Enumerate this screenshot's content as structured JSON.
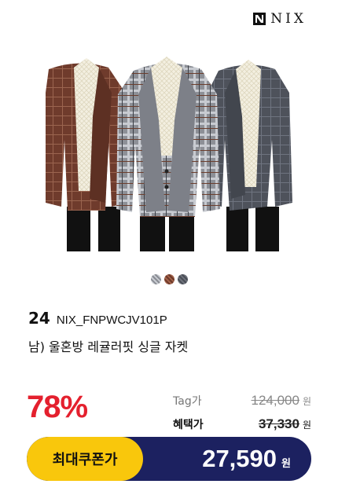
{
  "brand": {
    "name": "NIX",
    "icon": "nix-logo-icon"
  },
  "swatches": [
    {
      "name": "gray-plaid",
      "color": "#9a9da4"
    },
    {
      "name": "brown-check",
      "color": "#8a4a36"
    },
    {
      "name": "charcoal",
      "color": "#5a5e67"
    }
  ],
  "product": {
    "code_number": "24",
    "code": "NIX_FNPWCJV101P",
    "title": "남) 울혼방 레귤러핏 싱글 자켓"
  },
  "pricing": {
    "discount": "78%",
    "tag_label": "Tag가",
    "tag_price": "124,000",
    "sale_label": "혜택가",
    "sale_price": "37,330",
    "currency": "원"
  },
  "coupon": {
    "label": "최대쿠폰가",
    "price": "27,590",
    "currency": "원"
  },
  "colors": {
    "discount_red": "#e4202e",
    "coupon_navy": "#1c2160",
    "coupon_yellow": "#f9c70c"
  }
}
